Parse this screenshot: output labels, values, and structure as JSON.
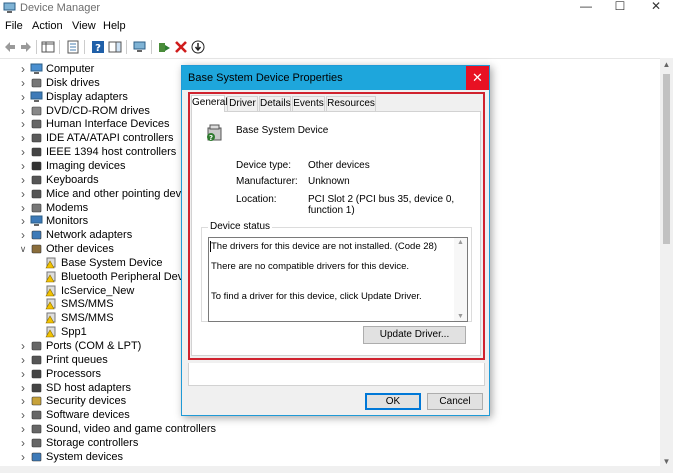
{
  "window": {
    "title": "Device Manager",
    "min_glyph": "—",
    "max_glyph": "☐",
    "close_glyph": "✕"
  },
  "menu": [
    "File",
    "Action",
    "View",
    "Help"
  ],
  "toolbar": {
    "icons": [
      "back-arrow-icon",
      "forward-arrow-icon",
      "show-hide-console-tree-icon",
      "properties-icon",
      "help-icon",
      "action-pane-icon",
      "scan-hardware-icon",
      "update-driver-icon",
      "uninstall-icon",
      "disable-device-icon"
    ]
  },
  "tree": [
    {
      "label": "Computer",
      "expanded": false,
      "indent": 0,
      "icon": "computer-icon"
    },
    {
      "label": "Disk drives",
      "expanded": false,
      "indent": 0,
      "icon": "disk-drive-icon"
    },
    {
      "label": "Display adapters",
      "expanded": false,
      "indent": 0,
      "icon": "display-adapter-icon"
    },
    {
      "label": "DVD/CD-ROM drives",
      "expanded": false,
      "indent": 0,
      "icon": "dvd-drive-icon"
    },
    {
      "label": "Human Interface Devices",
      "expanded": false,
      "indent": 0,
      "icon": "hid-icon"
    },
    {
      "label": "IDE ATA/ATAPI controllers",
      "expanded": false,
      "indent": 0,
      "icon": "ide-controller-icon"
    },
    {
      "label": "IEEE 1394 host controllers",
      "expanded": false,
      "indent": 0,
      "icon": "ieee1394-icon"
    },
    {
      "label": "Imaging devices",
      "expanded": false,
      "indent": 0,
      "icon": "camera-icon"
    },
    {
      "label": "Keyboards",
      "expanded": false,
      "indent": 0,
      "icon": "keyboard-icon"
    },
    {
      "label": "Mice and other pointing devices",
      "expanded": false,
      "indent": 0,
      "icon": "mouse-icon"
    },
    {
      "label": "Modems",
      "expanded": false,
      "indent": 0,
      "icon": "modem-icon"
    },
    {
      "label": "Monitors",
      "expanded": false,
      "indent": 0,
      "icon": "monitor-icon"
    },
    {
      "label": "Network adapters",
      "expanded": false,
      "indent": 0,
      "icon": "network-adapter-icon"
    },
    {
      "label": "Other devices",
      "expanded": true,
      "indent": 0,
      "icon": "other-devices-icon"
    },
    {
      "label": "Base System Device",
      "expanded": null,
      "indent": 1,
      "icon": "unknown-device-warning-icon"
    },
    {
      "label": "Bluetooth Peripheral Device",
      "expanded": null,
      "indent": 1,
      "icon": "unknown-device-warning-icon"
    },
    {
      "label": "IcService_New",
      "expanded": null,
      "indent": 1,
      "icon": "unknown-device-warning-icon"
    },
    {
      "label": "SMS/MMS",
      "expanded": null,
      "indent": 1,
      "icon": "unknown-device-warning-icon"
    },
    {
      "label": "SMS/MMS",
      "expanded": null,
      "indent": 1,
      "icon": "unknown-device-warning-icon"
    },
    {
      "label": "Spp1",
      "expanded": null,
      "indent": 1,
      "icon": "unknown-device-warning-icon"
    },
    {
      "label": "Ports (COM & LPT)",
      "expanded": false,
      "indent": 0,
      "icon": "port-icon"
    },
    {
      "label": "Print queues",
      "expanded": false,
      "indent": 0,
      "icon": "printer-icon"
    },
    {
      "label": "Processors",
      "expanded": false,
      "indent": 0,
      "icon": "processor-icon"
    },
    {
      "label": "SD host adapters",
      "expanded": false,
      "indent": 0,
      "icon": "sd-card-icon"
    },
    {
      "label": "Security devices",
      "expanded": false,
      "indent": 0,
      "icon": "security-key-icon"
    },
    {
      "label": "Software devices",
      "expanded": false,
      "indent": 0,
      "icon": "software-device-icon"
    },
    {
      "label": "Sound, video and game controllers",
      "expanded": false,
      "indent": 0,
      "icon": "speaker-icon"
    },
    {
      "label": "Storage controllers",
      "expanded": false,
      "indent": 0,
      "icon": "storage-controller-icon"
    },
    {
      "label": "System devices",
      "expanded": false,
      "indent": 0,
      "icon": "system-device-icon"
    }
  ],
  "dialog": {
    "title": "Base System Device Properties",
    "close_glyph": "✕",
    "tabs": [
      "General",
      "Driver",
      "Details",
      "Events",
      "Resources"
    ],
    "active_tab": "General",
    "device_name": "Base System Device",
    "props": [
      {
        "label": "Device type:",
        "value": "Other devices"
      },
      {
        "label": "Manufacturer:",
        "value": "Unknown"
      },
      {
        "label": "Location:",
        "value": "PCI Slot 2 (PCI bus 35, device 0, function 1)"
      }
    ],
    "status_legend": "Device status",
    "status_lines": [
      "The drivers for this device are not installed. (Code 28)",
      "There are no compatible drivers for this device.",
      "To find a driver for this device, click Update Driver."
    ],
    "update_driver_label": "Update Driver...",
    "ok_label": "OK",
    "cancel_label": "Cancel"
  },
  "colors": {
    "dialog_title_bg": "#1ea6dc",
    "close_button_bg": "#e81123",
    "highlight_border": "#d0222e"
  }
}
